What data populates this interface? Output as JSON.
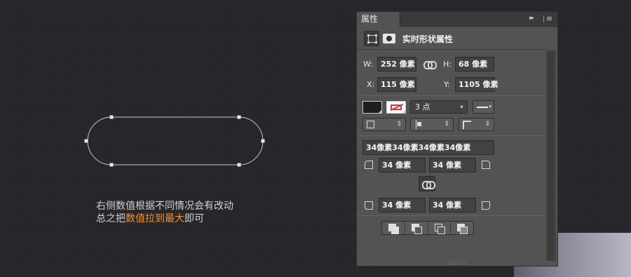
{
  "canvas": {
    "caption_line1": "右侧数值根据不同情况会有改动",
    "caption_line2_prefix": "总之把",
    "caption_line2_highlight": "数值拉到最大",
    "caption_line2_suffix": "即可",
    "highlight_color": "#f0942f",
    "shape": "rounded-rectangle-path"
  },
  "panel": {
    "tab_label": "属性",
    "collapse_glyph": "▸▸",
    "menu_glyph": "≡",
    "header_title": "实时形状属性",
    "size": {
      "w_label": "W:",
      "w_value": "252 像素",
      "h_label": "H:",
      "h_value": "68 像素",
      "x_label": "X:",
      "x_value": "115 像素",
      "y_label": "Y:",
      "y_value": "1105 像素"
    },
    "stroke": {
      "width_value": "3 点",
      "dropdown_arrow": "▾",
      "updown_glyph": "⇕"
    },
    "corners": {
      "combined_value": "34像素34像素34像素34像素",
      "top_left": "34 像素",
      "top_right": "34 像素",
      "bottom_left": "34 像素",
      "bottom_right": "34 像素"
    }
  }
}
